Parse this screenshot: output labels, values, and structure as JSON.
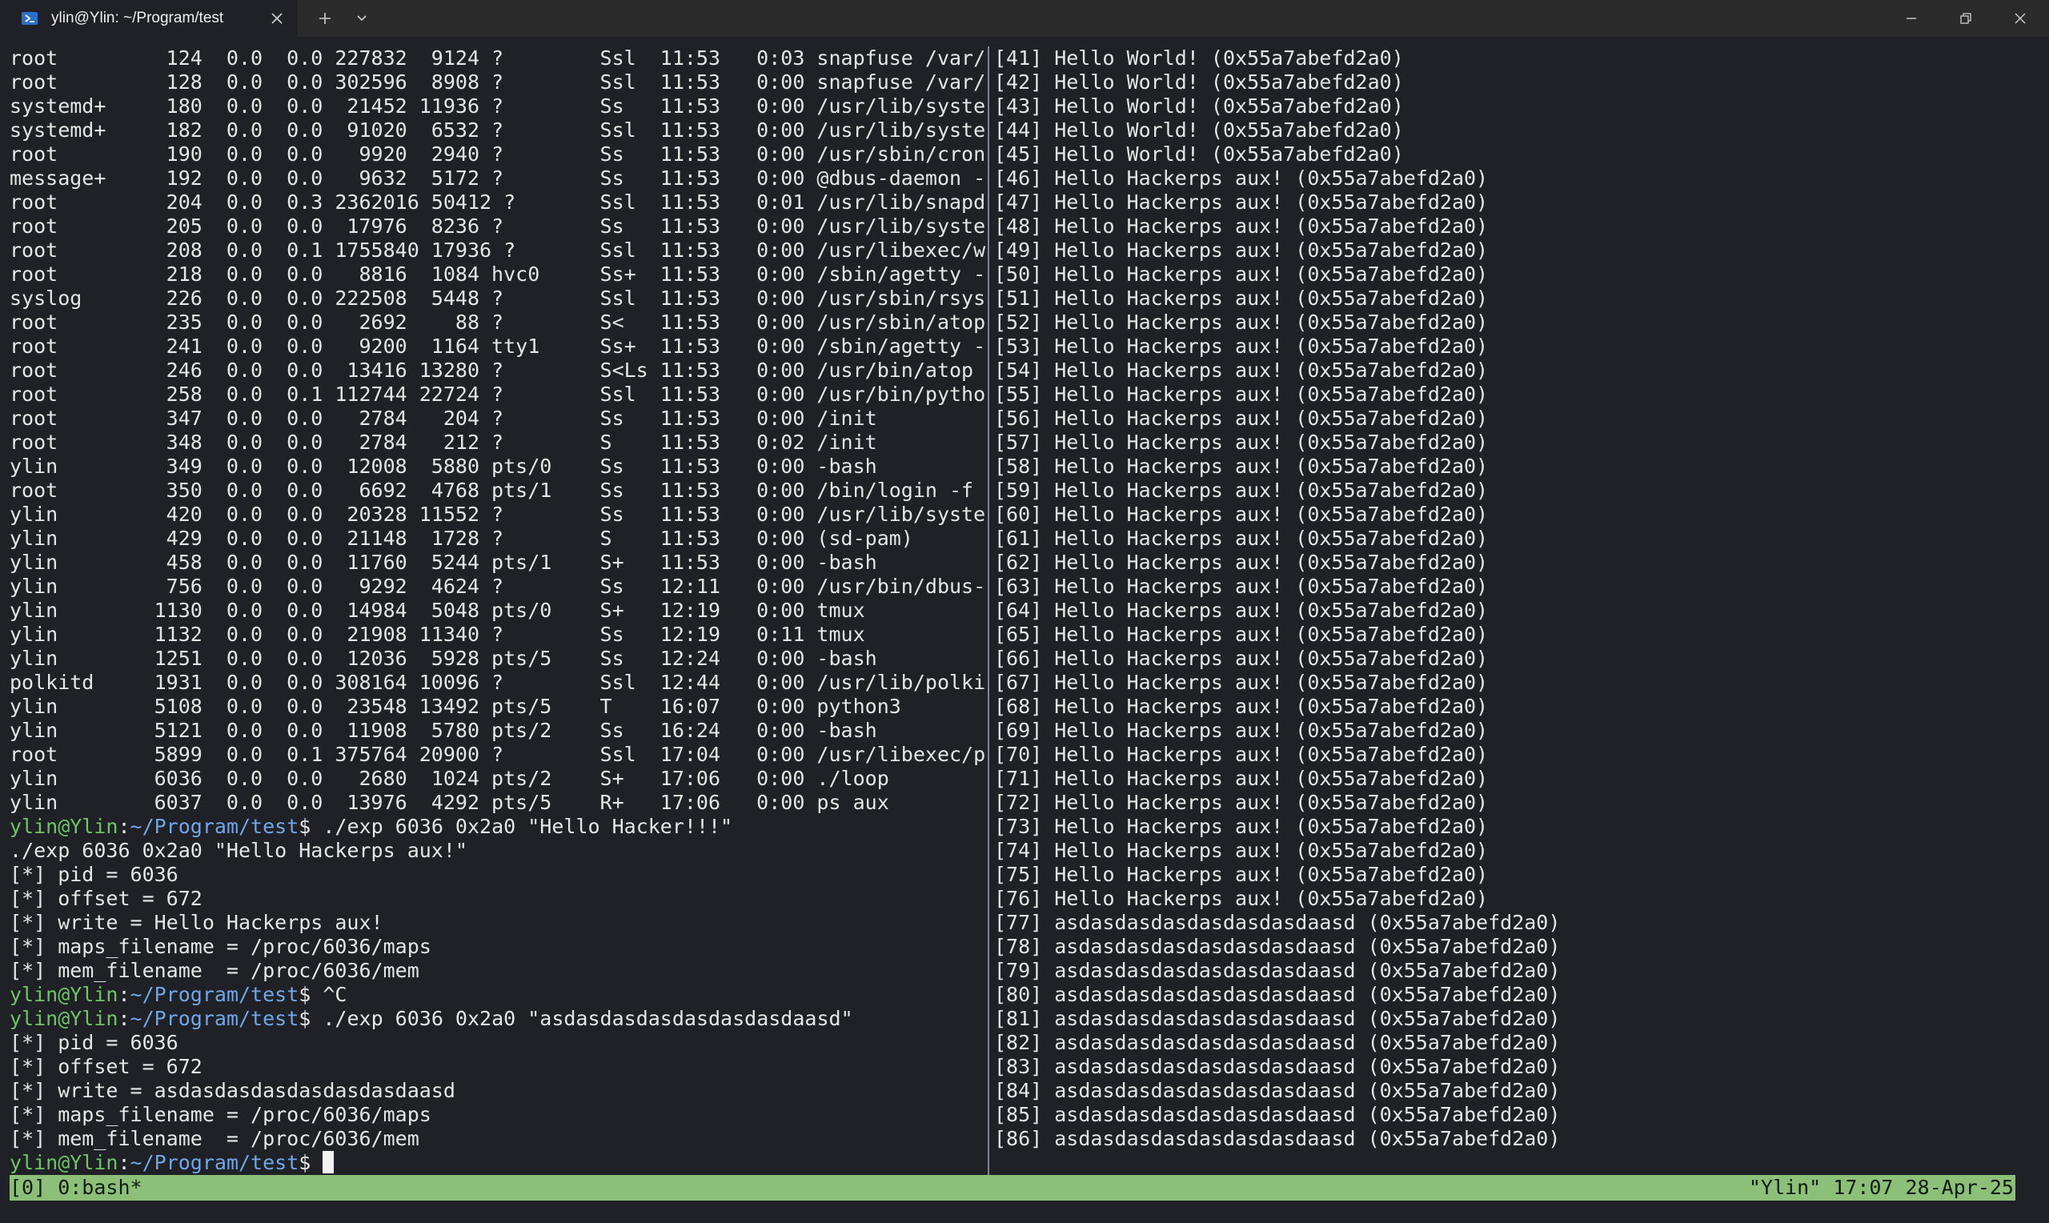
{
  "window": {
    "tab_title": "ylin@Ylin: ~/Program/test"
  },
  "left_pane": {
    "ps_rows": [
      "root         124  0.0  0.0 227832  9124 ?        Ssl  11:53   0:03 snapfuse /var/",
      "root         128  0.0  0.0 302596  8908 ?        Ssl  11:53   0:00 snapfuse /var/",
      "systemd+     180  0.0  0.0  21452 11936 ?        Ss   11:53   0:00 /usr/lib/syste",
      "systemd+     182  0.0  0.0  91020  6532 ?        Ssl  11:53   0:00 /usr/lib/syste",
      "root         190  0.0  0.0   9920  2940 ?        Ss   11:53   0:00 /usr/sbin/cron",
      "message+     192  0.0  0.0   9632  5172 ?        Ss   11:53   0:00 @dbus-daemon -",
      "root         204  0.0  0.3 2362016 50412 ?       Ssl  11:53   0:01 /usr/lib/snapd",
      "root         205  0.0  0.0  17976  8236 ?        Ss   11:53   0:00 /usr/lib/syste",
      "root         208  0.0  0.1 1755840 17936 ?       Ssl  11:53   0:00 /usr/libexec/w",
      "root         218  0.0  0.0   8816  1084 hvc0     Ss+  11:53   0:00 /sbin/agetty -",
      "syslog       226  0.0  0.0 222508  5448 ?        Ssl  11:53   0:00 /usr/sbin/rsys",
      "root         235  0.0  0.0   2692    88 ?        S<   11:53   0:00 /usr/sbin/atop",
      "root         241  0.0  0.0   9200  1164 tty1     Ss+  11:53   0:00 /sbin/agetty -",
      "root         246  0.0  0.0  13416 13280 ?        S<Ls 11:53   0:00 /usr/bin/atop",
      "root         258  0.0  0.1 112744 22724 ?        Ssl  11:53   0:00 /usr/bin/pytho",
      "root         347  0.0  0.0   2784   204 ?        Ss   11:53   0:00 /init",
      "root         348  0.0  0.0   2784   212 ?        S    11:53   0:02 /init",
      "ylin         349  0.0  0.0  12008  5880 pts/0    Ss   11:53   0:00 -bash",
      "root         350  0.0  0.0   6692  4768 pts/1    Ss   11:53   0:00 /bin/login -f",
      "ylin         420  0.0  0.0  20328 11552 ?        Ss   11:53   0:00 /usr/lib/syste",
      "ylin         429  0.0  0.0  21148  1728 ?        S    11:53   0:00 (sd-pam)",
      "ylin         458  0.0  0.0  11760  5244 pts/1    S+   11:53   0:00 -bash",
      "ylin         756  0.0  0.0   9292  4624 ?        Ss   12:11   0:00 /usr/bin/dbus-",
      "ylin        1130  0.0  0.0  14984  5048 pts/0    S+   12:19   0:00 tmux",
      "ylin        1132  0.0  0.0  21908 11340 ?        Ss   12:19   0:11 tmux",
      "ylin        1251  0.0  0.0  12036  5928 pts/5    Ss   12:24   0:00 -bash",
      "polkitd     1931  0.0  0.0 308164 10096 ?        Ssl  12:44   0:00 /usr/lib/polki",
      "ylin        5108  0.0  0.0  23548 13492 pts/5    T    16:07   0:00 python3",
      "ylin        5121  0.0  0.0  11908  5780 pts/2    Ss   16:24   0:00 -bash",
      "root        5899  0.0  0.1 375764 20900 ?        Ssl  17:04   0:00 /usr/libexec/p",
      "ylin        6036  0.0  0.0   2680  1024 pts/2    S+   17:06   0:00 ./loop",
      "ylin        6037  0.0  0.0  13976  4292 pts/5    R+   17:06   0:00 ps aux"
    ],
    "prompt_user": "ylin@Ylin",
    "prompt_colon": ":",
    "prompt_path": "~/Program/test",
    "prompt_symbol": "$ ",
    "session": [
      {
        "kind": "prompt",
        "cmd": "./exp 6036 0x2a0 \"Hello Hacker!!!\""
      },
      {
        "kind": "out",
        "text": "./exp 6036 0x2a0 \"Hello Hackerps aux!\""
      },
      {
        "kind": "out",
        "text": "[*] pid = 6036"
      },
      {
        "kind": "out",
        "text": "[*] offset = 672"
      },
      {
        "kind": "out",
        "text": "[*] write = Hello Hackerps aux!"
      },
      {
        "kind": "out",
        "text": "[*] maps_filename = /proc/6036/maps"
      },
      {
        "kind": "out",
        "text": "[*] mem_filename  = /proc/6036/mem"
      },
      {
        "kind": "prompt",
        "cmd": "^C"
      },
      {
        "kind": "prompt",
        "cmd": "./exp 6036 0x2a0 \"asdasdasdasdasdasdasdaasd\""
      },
      {
        "kind": "out",
        "text": "[*] pid = 6036"
      },
      {
        "kind": "out",
        "text": "[*] offset = 672"
      },
      {
        "kind": "out",
        "text": "[*] write = asdasdasdasdasdasdasdaasd"
      },
      {
        "kind": "out",
        "text": "[*] maps_filename = /proc/6036/maps"
      },
      {
        "kind": "out",
        "text": "[*] mem_filename  = /proc/6036/mem"
      },
      {
        "kind": "prompt",
        "cmd": "",
        "cursor": true
      }
    ]
  },
  "right_pane": {
    "lines": [
      "[41] Hello World! (0x55a7abefd2a0)",
      "[42] Hello World! (0x55a7abefd2a0)",
      "[43] Hello World! (0x55a7abefd2a0)",
      "[44] Hello World! (0x55a7abefd2a0)",
      "[45] Hello World! (0x55a7abefd2a0)",
      "[46] Hello Hackerps aux! (0x55a7abefd2a0)",
      "[47] Hello Hackerps aux! (0x55a7abefd2a0)",
      "[48] Hello Hackerps aux! (0x55a7abefd2a0)",
      "[49] Hello Hackerps aux! (0x55a7abefd2a0)",
      "[50] Hello Hackerps aux! (0x55a7abefd2a0)",
      "[51] Hello Hackerps aux! (0x55a7abefd2a0)",
      "[52] Hello Hackerps aux! (0x55a7abefd2a0)",
      "[53] Hello Hackerps aux! (0x55a7abefd2a0)",
      "[54] Hello Hackerps aux! (0x55a7abefd2a0)",
      "[55] Hello Hackerps aux! (0x55a7abefd2a0)",
      "[56] Hello Hackerps aux! (0x55a7abefd2a0)",
      "[57] Hello Hackerps aux! (0x55a7abefd2a0)",
      "[58] Hello Hackerps aux! (0x55a7abefd2a0)",
      "[59] Hello Hackerps aux! (0x55a7abefd2a0)",
      "[60] Hello Hackerps aux! (0x55a7abefd2a0)",
      "[61] Hello Hackerps aux! (0x55a7abefd2a0)",
      "[62] Hello Hackerps aux! (0x55a7abefd2a0)",
      "[63] Hello Hackerps aux! (0x55a7abefd2a0)",
      "[64] Hello Hackerps aux! (0x55a7abefd2a0)",
      "[65] Hello Hackerps aux! (0x55a7abefd2a0)",
      "[66] Hello Hackerps aux! (0x55a7abefd2a0)",
      "[67] Hello Hackerps aux! (0x55a7abefd2a0)",
      "[68] Hello Hackerps aux! (0x55a7abefd2a0)",
      "[69] Hello Hackerps aux! (0x55a7abefd2a0)",
      "[70] Hello Hackerps aux! (0x55a7abefd2a0)",
      "[71] Hello Hackerps aux! (0x55a7abefd2a0)",
      "[72] Hello Hackerps aux! (0x55a7abefd2a0)",
      "[73] Hello Hackerps aux! (0x55a7abefd2a0)",
      "[74] Hello Hackerps aux! (0x55a7abefd2a0)",
      "[75] Hello Hackerps aux! (0x55a7abefd2a0)",
      "[76] Hello Hackerps aux! (0x55a7abefd2a0)",
      "[77] asdasdasdasdasdasdasdaasd (0x55a7abefd2a0)",
      "[78] asdasdasdasdasdasdasdaasd (0x55a7abefd2a0)",
      "[79] asdasdasdasdasdasdasdaasd (0x55a7abefd2a0)",
      "[80] asdasdasdasdasdasdasdaasd (0x55a7abefd2a0)",
      "[81] asdasdasdasdasdasdasdaasd (0x55a7abefd2a0)",
      "[82] asdasdasdasdasdasdasdaasd (0x55a7abefd2a0)",
      "[83] asdasdasdasdasdasdasdaasd (0x55a7abefd2a0)",
      "[84] asdasdasdasdasdasdasdaasd (0x55a7abefd2a0)",
      "[85] asdasdasdasdasdasdasdaasd (0x55a7abefd2a0)",
      "[86] asdasdasdasdasdasdasdaasd (0x55a7abefd2a0)"
    ]
  },
  "status_bar": {
    "left": "[0] 0:bash*",
    "right": "\"Ylin\" 17:07 28-Apr-25"
  },
  "icons": {
    "tab": "powershell-icon",
    "close": "close-icon",
    "new_tab": "plus-icon",
    "dropdown": "chevron-down-icon",
    "minimize": "minimize-icon",
    "maximize": "restore-icon",
    "window_close": "close-icon"
  },
  "colors": {
    "background": "#1f2127",
    "titlebar": "#2b2b2b",
    "prompt_user": "#6fc466",
    "prompt_path": "#6ea7ea",
    "status_bar": "#8cbf78"
  }
}
